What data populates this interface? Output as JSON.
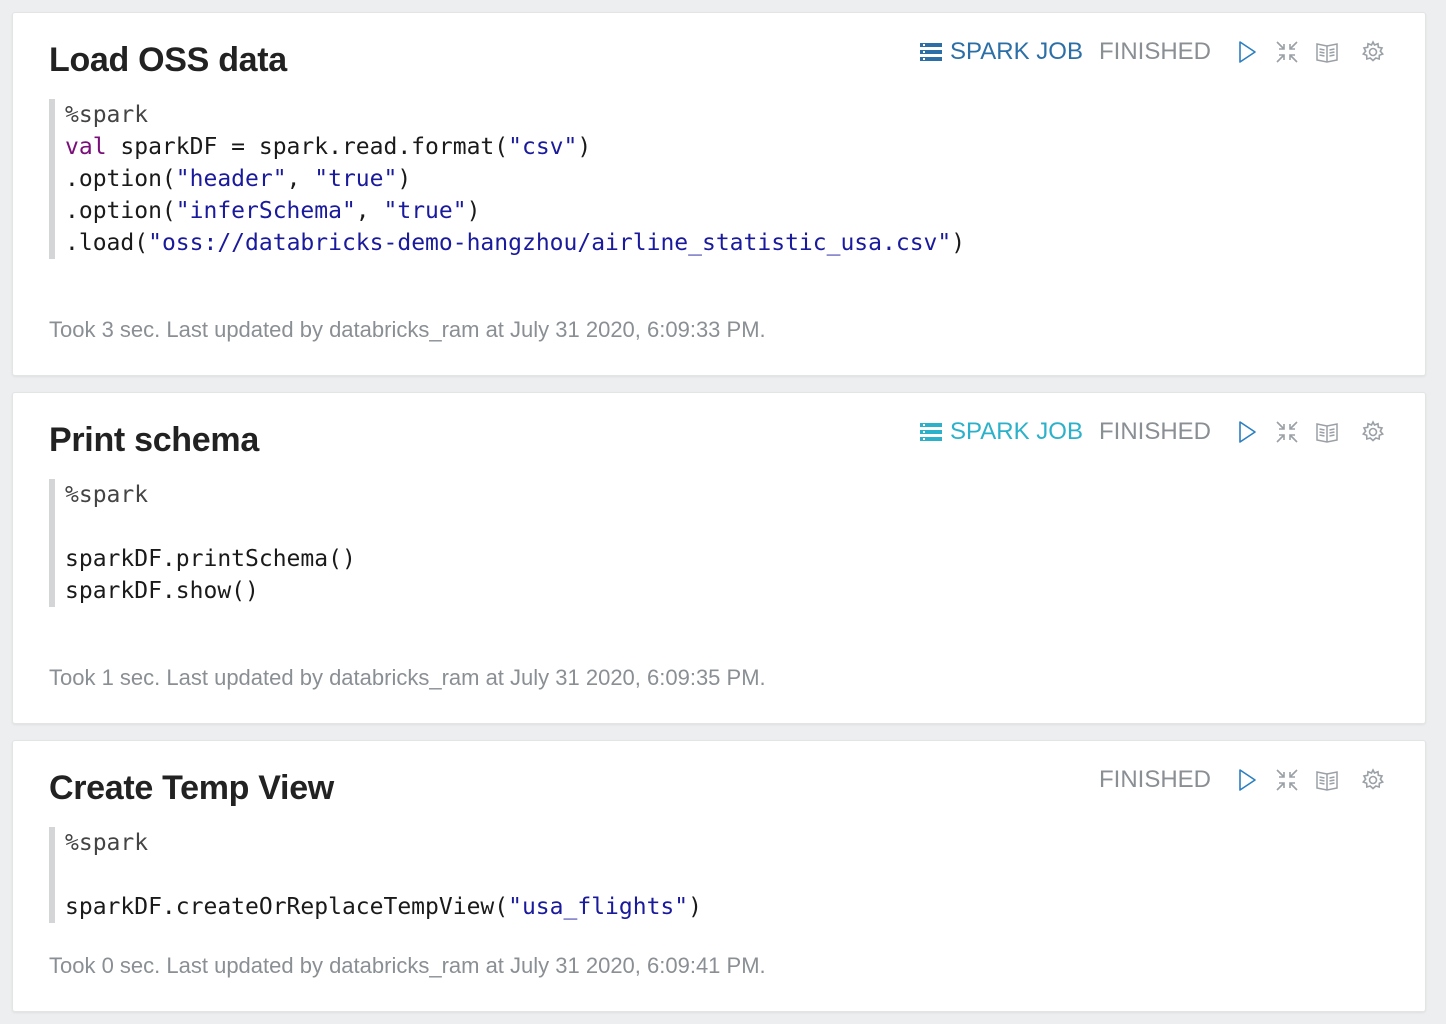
{
  "colors": {
    "spark_job_dark": "#2c6fa6",
    "spark_job_teal": "#2bb1c9",
    "status_grey": "#8a8f94",
    "icon_blue": "#2c7fc0",
    "icon_grey": "#9aa0a6"
  },
  "paragraphs": [
    {
      "title": "Load OSS data",
      "spark_job_label": "SPARK JOB",
      "status": "FINISHED",
      "code_lines": [
        [
          {
            "t": "%spark",
            "c": "mag"
          }
        ],
        [
          {
            "t": "val",
            "c": "kw"
          },
          {
            "t": " sparkDF = spark.read.format(",
            "c": ""
          },
          {
            "t": "\"csv\"",
            "c": "str"
          },
          {
            "t": ")",
            "c": ""
          }
        ],
        [
          {
            "t": ".option(",
            "c": ""
          },
          {
            "t": "\"header\"",
            "c": "str"
          },
          {
            "t": ", ",
            "c": ""
          },
          {
            "t": "\"true\"",
            "c": "str"
          },
          {
            "t": ")",
            "c": ""
          }
        ],
        [
          {
            "t": ".option(",
            "c": ""
          },
          {
            "t": "\"inferSchema\"",
            "c": "str"
          },
          {
            "t": ", ",
            "c": ""
          },
          {
            "t": "\"true\"",
            "c": "str"
          },
          {
            "t": ")",
            "c": ""
          }
        ],
        [
          {
            "t": ".load(",
            "c": ""
          },
          {
            "t": "\"oss://databricks-demo-hangzhou/airline_statistic_usa.csv\"",
            "c": "str"
          },
          {
            "t": ")",
            "c": ""
          }
        ]
      ],
      "footer": "Took 3 sec. Last updated by databricks_ram at July 31 2020, 6:09:33 PM."
    },
    {
      "title": "Print schema",
      "spark_job_label": "SPARK JOB",
      "status": "FINISHED",
      "code_lines": [
        [
          {
            "t": "%spark",
            "c": "mag"
          }
        ],
        [
          {
            "t": "",
            "c": ""
          }
        ],
        [
          {
            "t": "sparkDF.printSchema()",
            "c": ""
          }
        ],
        [
          {
            "t": "sparkDF.show()",
            "c": ""
          }
        ]
      ],
      "footer": "Took 1 sec. Last updated by databricks_ram at July 31 2020, 6:09:35 PM."
    },
    {
      "title": "Create Temp View",
      "status": "FINISHED",
      "code_lines": [
        [
          {
            "t": "%spark",
            "c": "mag"
          }
        ],
        [
          {
            "t": "",
            "c": ""
          }
        ],
        [
          {
            "t": "sparkDF.createOrReplaceTempView(",
            "c": ""
          },
          {
            "t": "\"usa_flights\"",
            "c": "str"
          },
          {
            "t": ")",
            "c": ""
          }
        ]
      ],
      "footer": "Took 0 sec. Last updated by databricks_ram at July 31 2020, 6:09:41 PM."
    }
  ],
  "icons": [
    "run-icon",
    "collapse-icon",
    "book-icon",
    "gear-icon"
  ]
}
